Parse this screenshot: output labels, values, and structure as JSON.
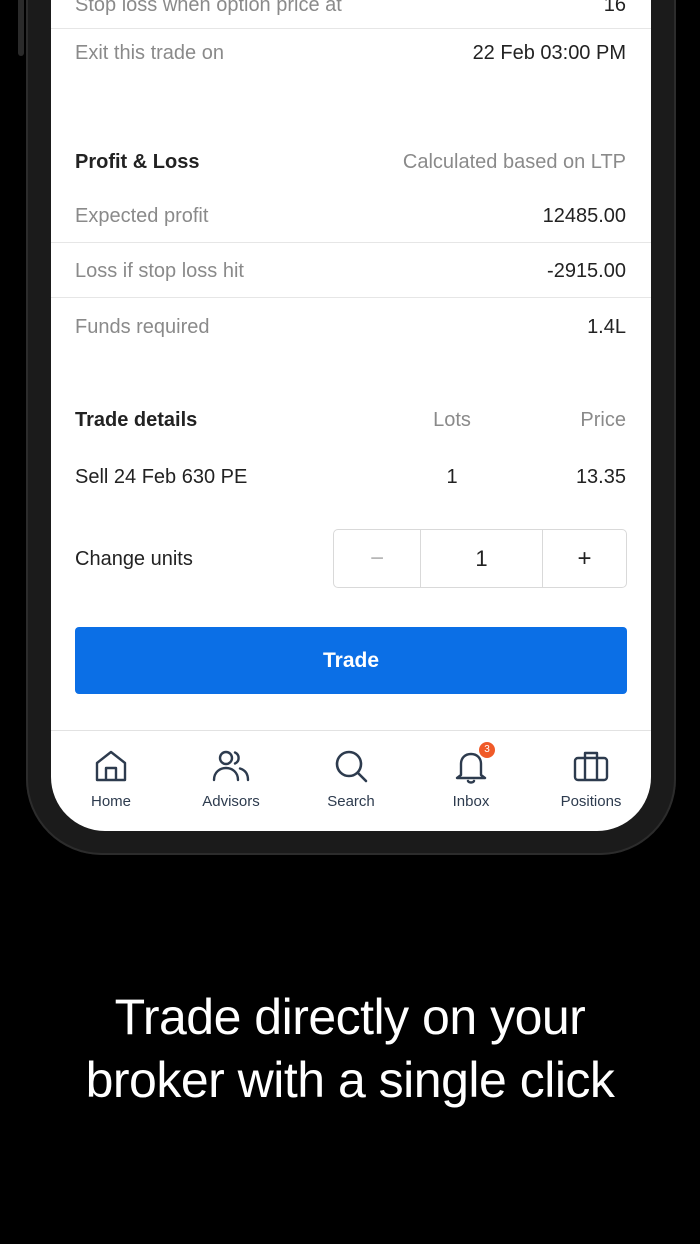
{
  "stop_loss": {
    "label": "Stop loss when option price at",
    "value": "16"
  },
  "exit": {
    "label": "Exit this trade on",
    "value": "22 Feb 03:00 PM"
  },
  "pnl": {
    "heading": "Profit & Loss",
    "note": "Calculated based on LTP",
    "expected_profit_label": "Expected profit",
    "expected_profit_value": "12485.00",
    "loss_label": "Loss if stop loss hit",
    "loss_value": "-2915.00",
    "funds_label": "Funds required",
    "funds_value": "1.4L"
  },
  "trade_details": {
    "heading": "Trade details",
    "col_lots": "Lots",
    "col_price": "Price",
    "leg": {
      "desc": "Sell 24 Feb 630 PE",
      "lots": "1",
      "price": "13.35"
    }
  },
  "units": {
    "label": "Change units",
    "minus": "−",
    "value": "1",
    "plus": "+"
  },
  "trade_button": "Trade",
  "nav": {
    "home": "Home",
    "advisors": "Advisors",
    "search": "Search",
    "inbox": "Inbox",
    "inbox_badge": "3",
    "positions": "Positions"
  },
  "tagline_line1": "Trade directly on your",
  "tagline_line2": "broker with a single click",
  "colors": {
    "accent": "#0b6fe6",
    "badge": "#f05a28",
    "nav_icon": "#2d3b4e"
  }
}
